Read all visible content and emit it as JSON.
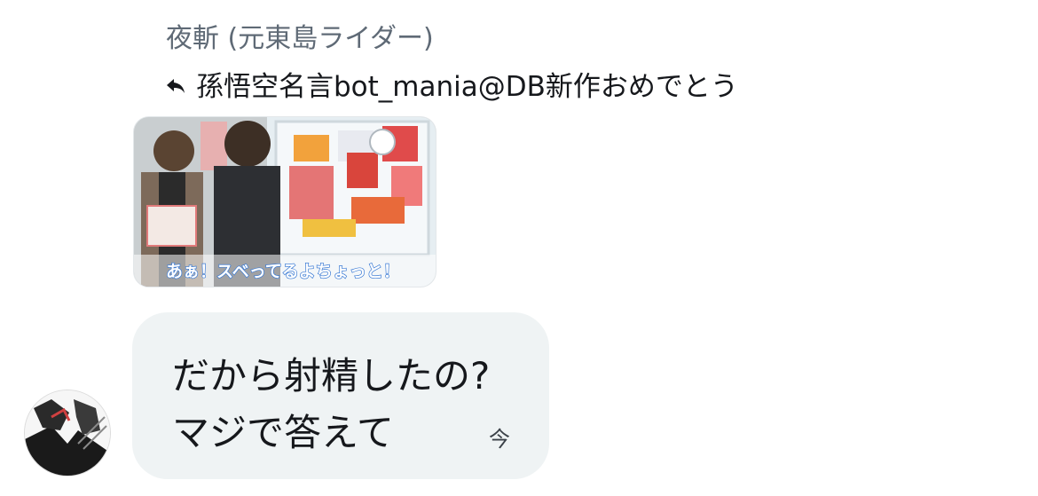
{
  "dm": {
    "sender_name": "夜斬 (元東島ライダー)",
    "reply_to": "孫悟空名言bot_mania@DB新作おめでとう",
    "media_caption": "あぁ！スベってるよちょっと！",
    "message_line1": "だから射精したの?",
    "message_line2": "マジで答えて",
    "timestamp": "今"
  },
  "icons": {
    "reply": "reply-arrow-icon"
  },
  "colors": {
    "bubble_bg": "#eff3f4",
    "sender_text": "#5f6a76",
    "primary_text": "#16181c"
  }
}
